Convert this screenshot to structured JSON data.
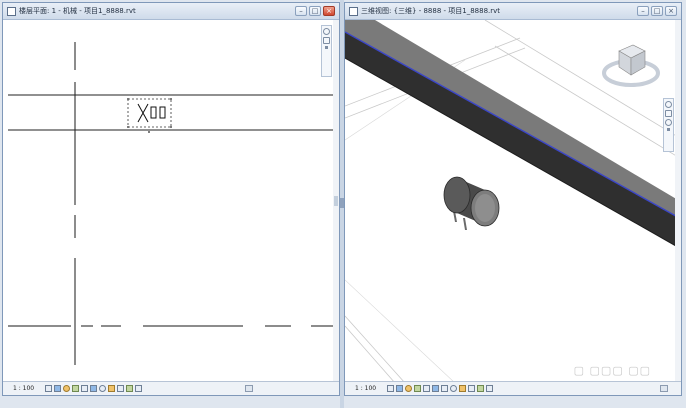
{
  "left_view": {
    "title": "楼层平面: 1 - 机械 - 项目1_8888.rvt",
    "scale": "1 : 100",
    "window_buttons": [
      "–",
      "□",
      "×"
    ]
  },
  "right_view": {
    "title": "三维视图: {三维} - 8888 - 项目1_8888.rvt",
    "scale": "1 : 100",
    "window_buttons": [
      "–",
      "□",
      "×"
    ]
  },
  "icons": {
    "view_cube": "view-cube-icon",
    "steering_wheel": "steering-wheel-icon",
    "zoom": "zoom-icon",
    "pan": "pan-icon"
  },
  "colors": {
    "title_bar": "#d7e2ef",
    "close_button": "#d0462f",
    "duct": "#3a3a3a",
    "duct_edge": "#3b46c8",
    "fan": "#555555"
  }
}
